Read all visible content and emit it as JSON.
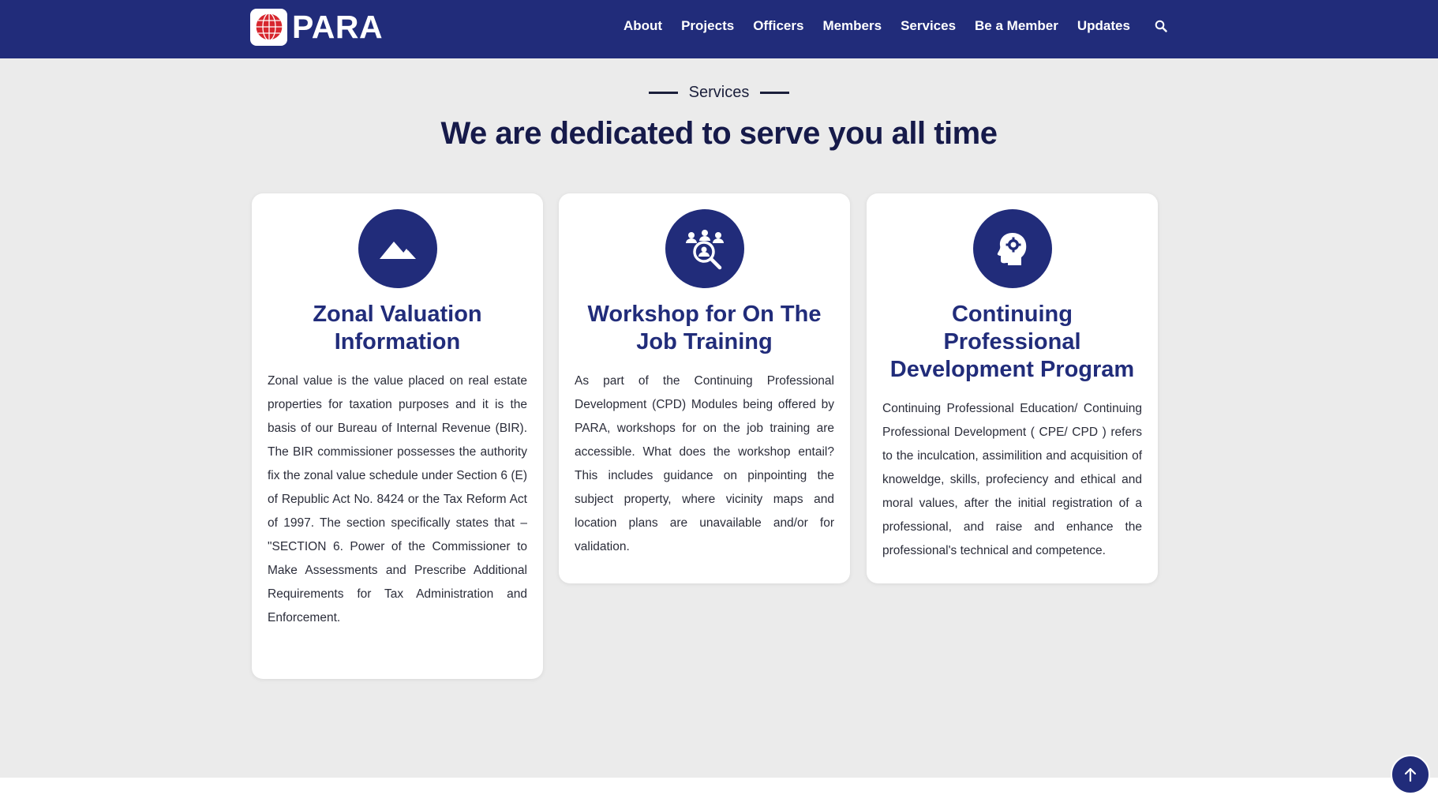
{
  "brand": {
    "name": "PARA",
    "accent": "#212c7a",
    "logo_red": "#d7262e"
  },
  "nav": {
    "items": [
      "About",
      "Projects",
      "Officers",
      "Members",
      "Services",
      "Be a Member",
      "Updates"
    ],
    "search_icon": "search-icon"
  },
  "section": {
    "eyebrow": "Services",
    "headline": "We are dedicated to serve you all time"
  },
  "cards": [
    {
      "icon": "mountain-icon",
      "title": "Zonal Valuation Information",
      "text": "Zonal value is the value placed on real estate properties for taxation purposes and it is the basis of our Bureau of Internal Revenue (BIR). The BIR commissioner possesses the authority fix the zonal value schedule under Section 6 (E) of Republic Act No. 8424 or the Tax Reform Act of 1997. The section specifically states that – \"SECTION 6. Power of the Commissioner to Make Assessments and Prescribe Additional Requirements for Tax Administration and Enforcement."
    },
    {
      "icon": "team-search-icon",
      "title": "Workshop for On The Job Training",
      "text": "As part of the Continuing Professional Development (CPD) Modules being offered by PARA, workshops for on the job training are accessible. What does the workshop entail? This includes guidance on pinpointing the subject property, where vicinity maps and location plans are unavailable and/or for validation."
    },
    {
      "icon": "head-gear-icon",
      "title": "Continuing Professional Development Program",
      "text": "Continuing Professional Education/ Continuing Professional Development ( CPE/ CPD ) refers to the inculcation, assimilition and acquisition of knoweldge, skills, profeciency and ethical and moral values, after the initial registration of a professional, and raise and enhance the professional's technical and competence."
    }
  ],
  "back_to_top": {
    "icon": "arrow-up-icon"
  }
}
